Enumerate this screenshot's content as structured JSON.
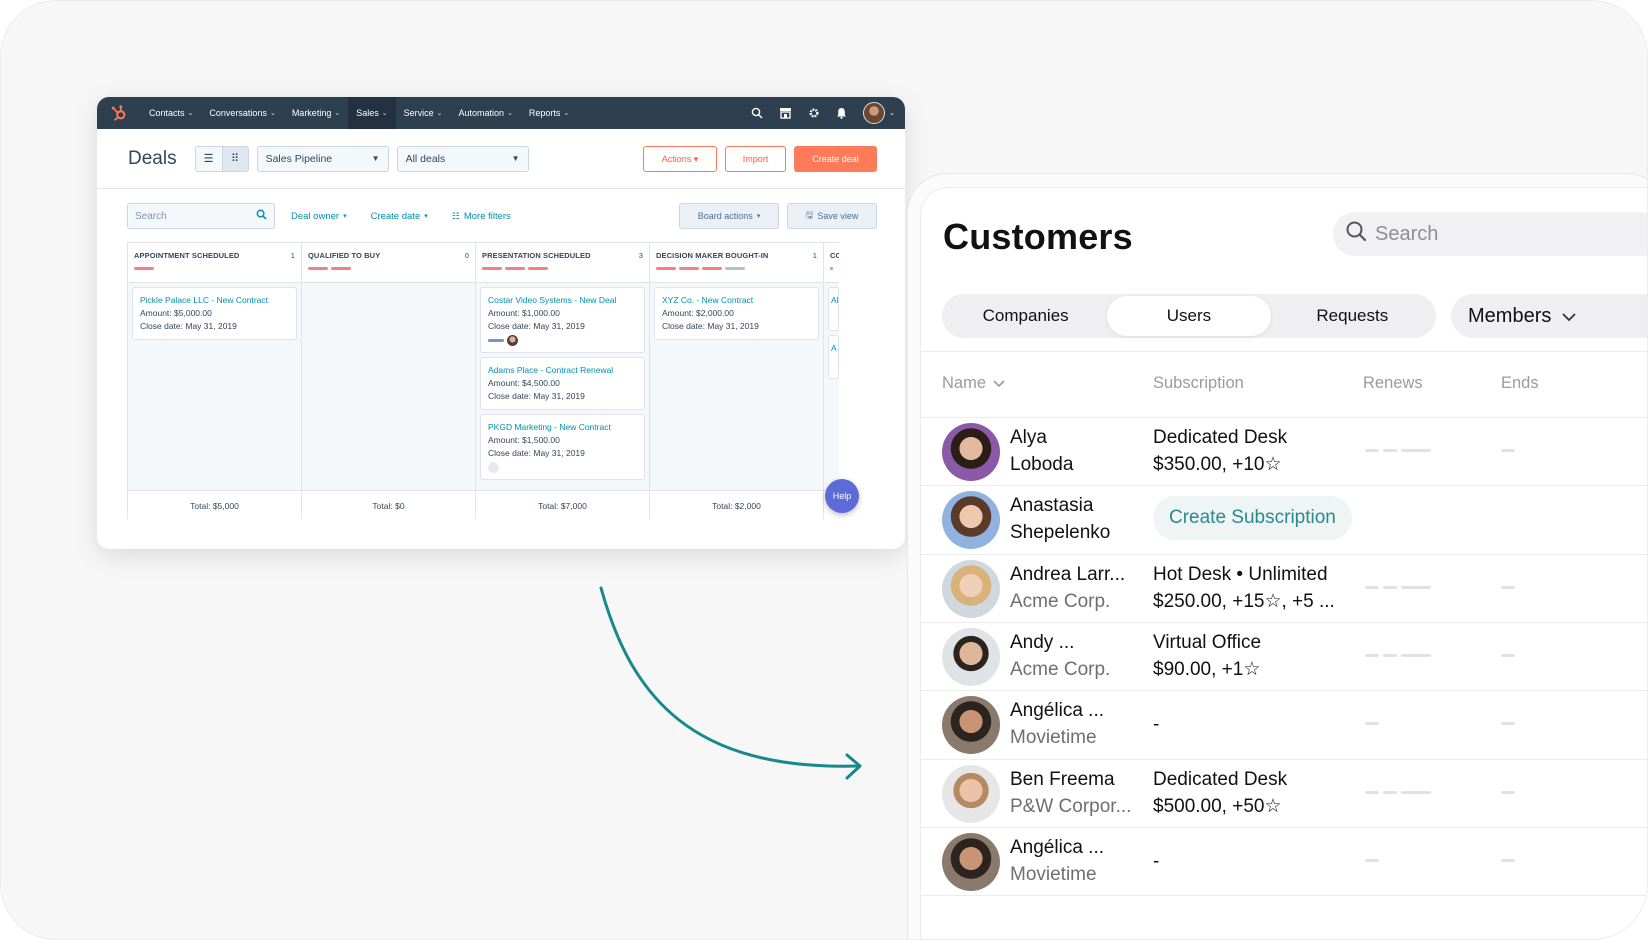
{
  "hubspot": {
    "nav": {
      "items": [
        {
          "label": "Contacts",
          "active": false
        },
        {
          "label": "Conversations",
          "active": false
        },
        {
          "label": "Marketing",
          "active": false
        },
        {
          "label": "Sales",
          "active": true
        },
        {
          "label": "Service",
          "active": false
        },
        {
          "label": "Automation",
          "active": false
        },
        {
          "label": "Reports",
          "active": false
        }
      ],
      "icons": [
        "search-icon",
        "marketplace-icon",
        "settings-icon",
        "notifications-icon"
      ]
    },
    "header": {
      "title": "Deals",
      "pipeline_select": "Sales Pipeline",
      "view_select": "All deals",
      "actions_label": "Actions",
      "import_label": "Import",
      "create_label": "Create deal"
    },
    "filters": {
      "search_placeholder": "Search",
      "deal_owner": "Deal owner",
      "create_date": "Create date",
      "more_filters": "More filters",
      "board_actions": "Board actions",
      "save_view": "Save view"
    },
    "board": {
      "columns": [
        {
          "title": "APPOINTMENT SCHEDULED",
          "count": "1",
          "total": "Total: $5,000",
          "cards": [
            {
              "name": "Pickle Palace LLC - New Contract",
              "amount": "$5,000.00",
              "close": "May 31, 2019"
            }
          ]
        },
        {
          "title": "QUALIFIED TO BUY",
          "count": "0",
          "total": "Total: $0",
          "cards": []
        },
        {
          "title": "PRESENTATION SCHEDULED",
          "count": "3",
          "total": "Total: $7,000",
          "cards": [
            {
              "name": "Costar Video Systems - New Deal",
              "amount": "$1,000.00",
              "close": "May 31, 2019"
            },
            {
              "name": "Adams Place - Contract Renewal",
              "amount": "$4,500.00",
              "close": "May 31, 2019"
            },
            {
              "name": "PKGD Marketing - New Contract",
              "amount": "$1,500.00",
              "close": "May 31, 2019"
            }
          ]
        },
        {
          "title": "DECISION MAKER BOUGHT-IN",
          "count": "1",
          "total": "Total: $2,000",
          "cards": [
            {
              "name": "XYZ Co. - New Contract",
              "amount": "$2,000.00",
              "close": "May 31, 2019"
            }
          ]
        },
        {
          "title": "COI",
          "count": "",
          "total": "",
          "cards": [
            {
              "name": "Al",
              "amount": "",
              "close": ""
            },
            {
              "name": "A",
              "amount": "",
              "close": ""
            }
          ]
        }
      ],
      "amount_label": "Amount:",
      "close_label": "Close date:"
    },
    "help_label": "Help"
  },
  "customers": {
    "title": "Customers",
    "search_placeholder": "Search",
    "tabs": [
      {
        "label": "Companies",
        "active": false
      },
      {
        "label": "Users",
        "active": true
      },
      {
        "label": "Requests",
        "active": false
      }
    ],
    "members_label": "Members",
    "columns": {
      "name": "Name",
      "subscription": "Subscription",
      "renews": "Renews",
      "ends": "Ends"
    },
    "rows": [
      {
        "name": "Alya",
        "name2": "Loboda",
        "company": "",
        "sub1": "Dedicated Desk",
        "sub2": "$350.00, +10☆",
        "create": ""
      },
      {
        "name": "Anastasia",
        "name2": "Shepelenko",
        "company": "",
        "sub1": "",
        "sub2": "",
        "create": "Create Subscription"
      },
      {
        "name": "Andrea Larr...",
        "name2": "",
        "company": "Acme Corp.",
        "sub1": "Hot Desk • Unlimited",
        "sub2": "$250.00, +15☆, +5 ...",
        "create": ""
      },
      {
        "name": "Andy ...",
        "name2": "",
        "company": "Acme Corp.",
        "sub1": "Virtual Office",
        "sub2": "$90.00, +1☆",
        "create": ""
      },
      {
        "name": "Angélica ...",
        "name2": "",
        "company": "Movietime",
        "sub1": "-",
        "sub2": "",
        "create": ""
      },
      {
        "name": "Ben Freema",
        "name2": "",
        "company": "P&W Corpor...",
        "sub1": "Dedicated Desk",
        "sub2": "$500.00, +50☆",
        "create": ""
      },
      {
        "name": "Angélica ...",
        "name2": "",
        "company": "Movietime",
        "sub1": "-",
        "sub2": "",
        "create": ""
      }
    ]
  },
  "colors": {
    "hubspot_nav": "#2e3f50",
    "hubspot_accent": "#ff7a59",
    "link": "#0091ae",
    "arrow": "#17888c",
    "create_subscription": "#2a8a8f"
  }
}
